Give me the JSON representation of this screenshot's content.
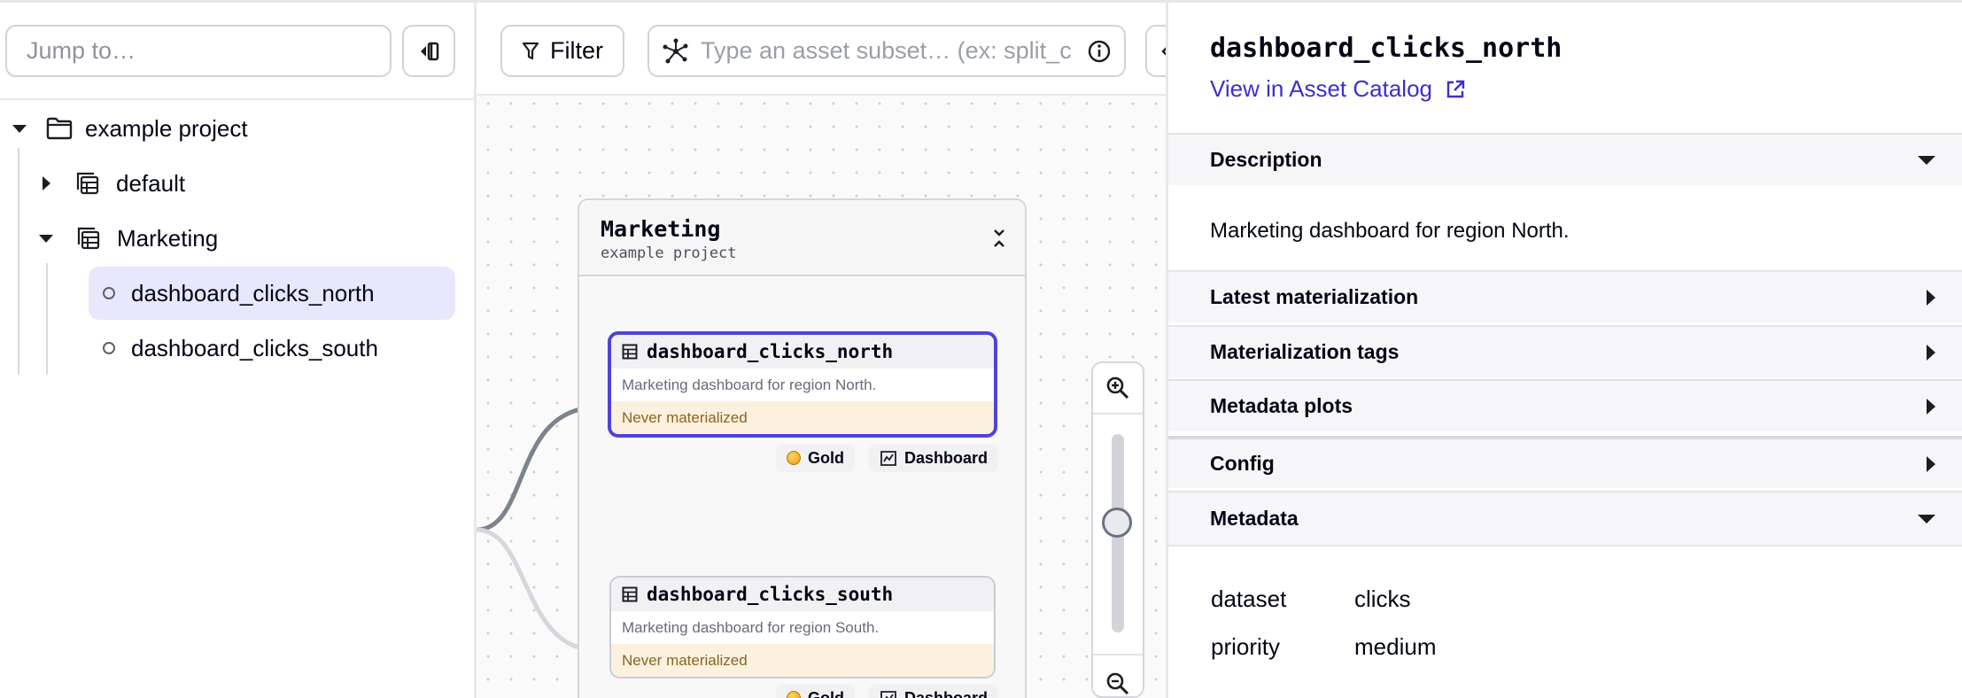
{
  "sidebar": {
    "jump_placeholder": "Jump to…",
    "tree": {
      "project": "example project",
      "groups": [
        {
          "label": "default",
          "expanded": false
        },
        {
          "label": "Marketing",
          "expanded": true
        }
      ],
      "assets": [
        {
          "label": "dashboard_clicks_north",
          "selected": true
        },
        {
          "label": "dashboard_clicks_south",
          "selected": false
        }
      ]
    }
  },
  "toolbar": {
    "filter_label": "Filter",
    "subset_placeholder": "Type an asset subset… (ex: split_cl"
  },
  "graph": {
    "group": {
      "name": "Marketing",
      "location": "example project"
    },
    "nodes": [
      {
        "name": "dashboard_clicks_north",
        "description": "Marketing dashboard for region North.",
        "status": "Never materialized",
        "tags": [
          "Gold",
          "Dashboard"
        ]
      },
      {
        "name": "dashboard_clicks_south",
        "description": "Marketing dashboard for region South.",
        "status": "Never materialized",
        "tags": [
          "Gold",
          "Dashboard"
        ]
      }
    ]
  },
  "panel": {
    "title": "dashboard_clicks_north",
    "catalog_link": "View in Asset Catalog",
    "sections": {
      "description": {
        "label": "Description",
        "text": "Marketing dashboard for region North."
      },
      "latest_materialization": "Latest materialization",
      "materialization_tags": "Materialization tags",
      "metadata_plots": "Metadata plots",
      "config": "Config",
      "metadata": {
        "label": "Metadata",
        "rows": [
          {
            "key": "dataset",
            "value": "clicks"
          },
          {
            "key": "priority",
            "value": "medium"
          }
        ]
      }
    }
  },
  "colors": {
    "accent": "#4f43dd",
    "link": "#3d2ecf",
    "selected_bg": "#e9e7fb",
    "status_bg": "#fcf0df"
  }
}
